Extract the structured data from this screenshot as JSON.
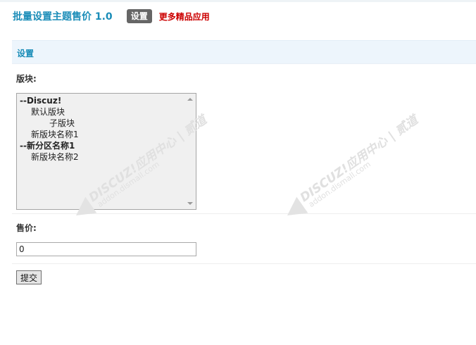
{
  "header": {
    "app_title": "批量设置主题售价 1.0",
    "tab_label": "设置",
    "more_label": "更多精品应用"
  },
  "section": {
    "title": "设置"
  },
  "forum_field": {
    "label": "版块:",
    "options": [
      {
        "text": "--Discuz!",
        "bold": true,
        "level": 0
      },
      {
        "text": "默认版块",
        "bold": false,
        "level": 1
      },
      {
        "text": "子版块",
        "bold": false,
        "level": 2
      },
      {
        "text": "新版块名称1",
        "bold": false,
        "level": 1
      },
      {
        "text": "--新分区名称1",
        "bold": true,
        "level": 0
      },
      {
        "text": "新版块名称2",
        "bold": false,
        "level": 1
      }
    ]
  },
  "price_field": {
    "label": "售价:",
    "value": "0"
  },
  "submit_label": "提交",
  "watermark": {
    "line1": "DISCUZ!应用中心 | 贰道",
    "line2": "addon.dismall.com"
  }
}
